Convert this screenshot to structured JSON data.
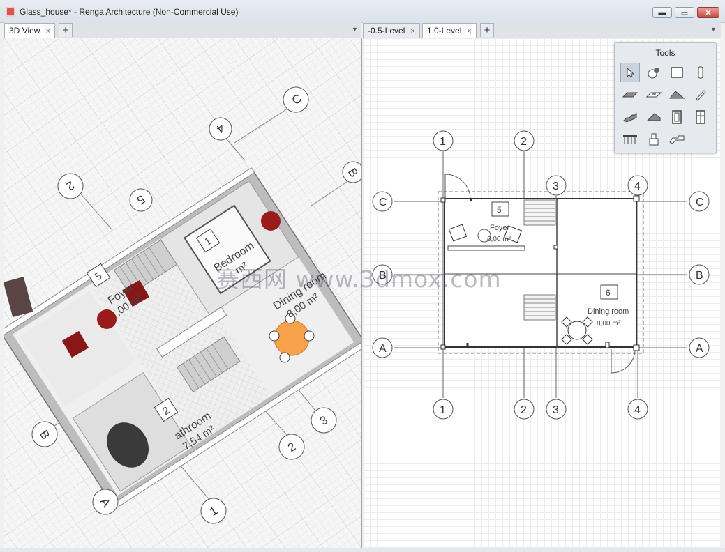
{
  "window": {
    "title": "Glass_house* - Renga Architecture (Non-Commercial Use)",
    "min_glyph": "▬",
    "max_glyph": "▭",
    "close_glyph": "✕"
  },
  "left_tabs": [
    {
      "label": "3D View",
      "close": "×"
    }
  ],
  "right_tabs": [
    {
      "label": "-0.5-Level",
      "close": "×"
    },
    {
      "label": "1.0-Level",
      "close": "×"
    }
  ],
  "tab_add": "+",
  "tab_menu": "▼",
  "tools": {
    "title": "Tools",
    "items": [
      "select-icon",
      "object-style-icon",
      "wall-icon",
      "column-icon",
      "slab-icon",
      "opening-icon",
      "roof-icon",
      "beam-icon",
      "stair-icon",
      "ramp-icon",
      "door-icon",
      "window-icon",
      "railing-icon",
      "equipment-icon",
      "element-icon"
    ]
  },
  "plan": {
    "axes_vertical": [
      "1",
      "2",
      "3",
      "4"
    ],
    "axes_horizontal": [
      "C",
      "B",
      "A"
    ],
    "rooms": [
      {
        "number": "5",
        "name": "Foyer",
        "area": "6,00 m²"
      },
      {
        "number": "6",
        "name": "Dining room",
        "area": "8,00 m²"
      }
    ]
  },
  "model3d": {
    "axes": [
      "C",
      "4",
      "B",
      "2",
      "5",
      "1",
      "2",
      "3",
      "B",
      "A",
      "1"
    ],
    "rooms": [
      {
        "number": "1",
        "name": "Bedroom",
        "area": "m²"
      },
      {
        "number": "5",
        "name": "Foyer",
        "area": ",00 m²"
      },
      {
        "number": "2",
        "name": "athroom",
        "area": "7,54 m²"
      },
      {
        "number": "",
        "name": "Dining room",
        "area": "8,00 m²"
      }
    ]
  },
  "watermark": "赛西网 www.3dmox.com",
  "colors": {
    "accent_orange": "#f7a24a",
    "chair_red": "#9b1a1a",
    "selection": "#c9d3dd"
  }
}
